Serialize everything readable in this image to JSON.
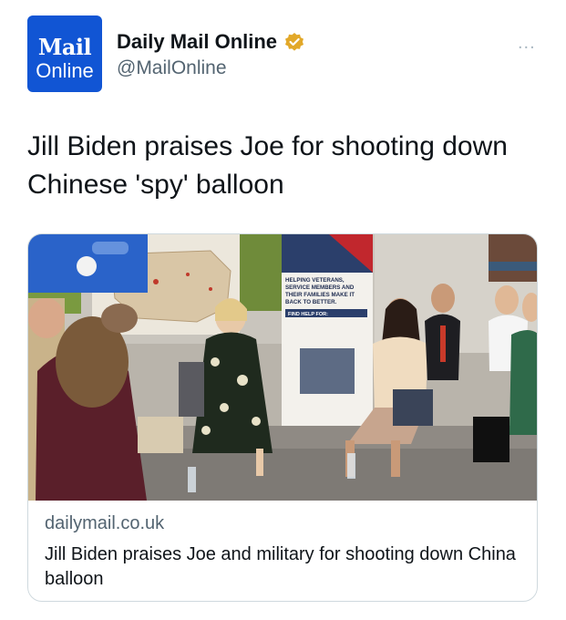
{
  "account": {
    "avatar_line1": "Mail",
    "avatar_line2": "Online",
    "display_name": "Daily Mail Online",
    "handle": "@MailOnline",
    "verified": true,
    "brand_color": "#1155d4",
    "badge_color": "#e2a829",
    "more_label": "..."
  },
  "tweet": {
    "text": "Jill Biden praises Joe for shooting down Chinese 'spy' balloon"
  },
  "card": {
    "domain": "dailymail.co.uk",
    "title": "Jill Biden praises Joe and military for shooting down China balloon",
    "image": {
      "description_icon": "news-photo",
      "banner_lines": [
        "HELPING VETERANS,",
        "SERVICE MEMBERS AND",
        "THEIR FAMILIES MAKE IT",
        "BACK TO BETTER."
      ],
      "banner_subhead": "FIND HELP FOR:"
    }
  }
}
